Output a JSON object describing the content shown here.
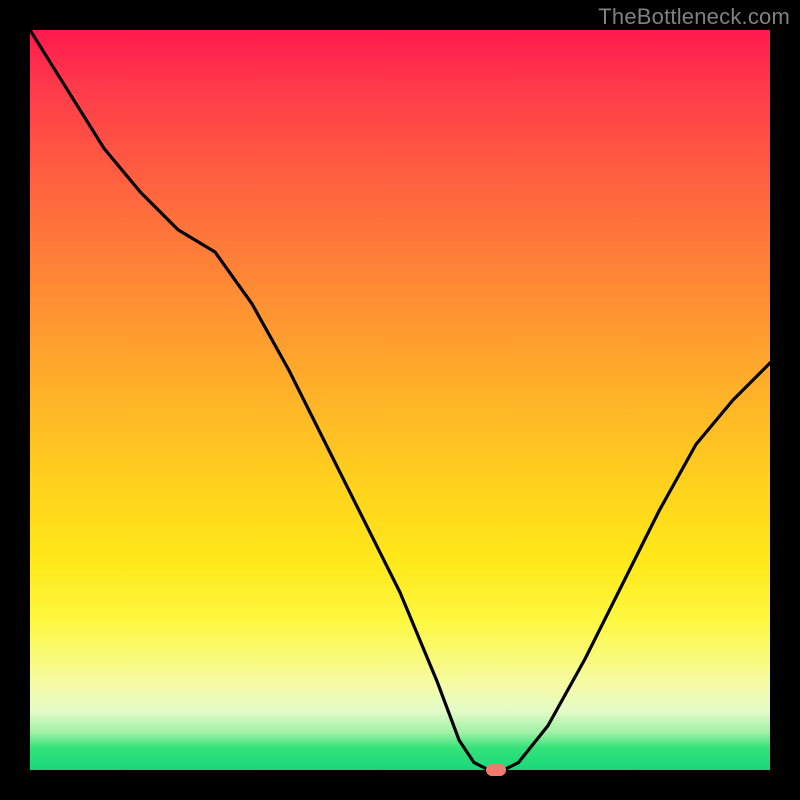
{
  "watermark": "TheBottleneck.com",
  "colors": {
    "background": "#000000",
    "curve": "#000000",
    "marker": "#f17a6f",
    "watermark": "#808080"
  },
  "chart_data": {
    "type": "line",
    "title": "",
    "xlabel": "",
    "ylabel": "",
    "xlim": [
      0,
      100
    ],
    "ylim": [
      0,
      100
    ],
    "grid": false,
    "legend": false,
    "series": [
      {
        "name": "bottleneck-curve",
        "x": [
          0,
          5,
          10,
          15,
          20,
          25,
          30,
          35,
          40,
          45,
          50,
          55,
          58,
          60,
          62,
          64,
          66,
          70,
          75,
          80,
          85,
          90,
          95,
          100
        ],
        "y": [
          100,
          92,
          84,
          78,
          73,
          70,
          63,
          54,
          44,
          34,
          24,
          12,
          4,
          1,
          0,
          0,
          1,
          6,
          15,
          25,
          35,
          44,
          50,
          55
        ]
      }
    ],
    "optimum_marker": {
      "x": 63,
      "y": 0
    },
    "background_gradient_stops": [
      {
        "pos": 0.0,
        "color": "#ff1a4d"
      },
      {
        "pos": 0.08,
        "color": "#ff3b4a"
      },
      {
        "pos": 0.2,
        "color": "#ff6040"
      },
      {
        "pos": 0.35,
        "color": "#ff8b34"
      },
      {
        "pos": 0.5,
        "color": "#ffb428"
      },
      {
        "pos": 0.62,
        "color": "#ffd31c"
      },
      {
        "pos": 0.72,
        "color": "#ffe91a"
      },
      {
        "pos": 0.8,
        "color": "#fdf842"
      },
      {
        "pos": 0.88,
        "color": "#f6fba0"
      },
      {
        "pos": 0.92,
        "color": "#e4fbc8"
      },
      {
        "pos": 0.95,
        "color": "#9ef0a4"
      },
      {
        "pos": 0.97,
        "color": "#35e27a"
      },
      {
        "pos": 1.0,
        "color": "#18d87a"
      }
    ]
  }
}
